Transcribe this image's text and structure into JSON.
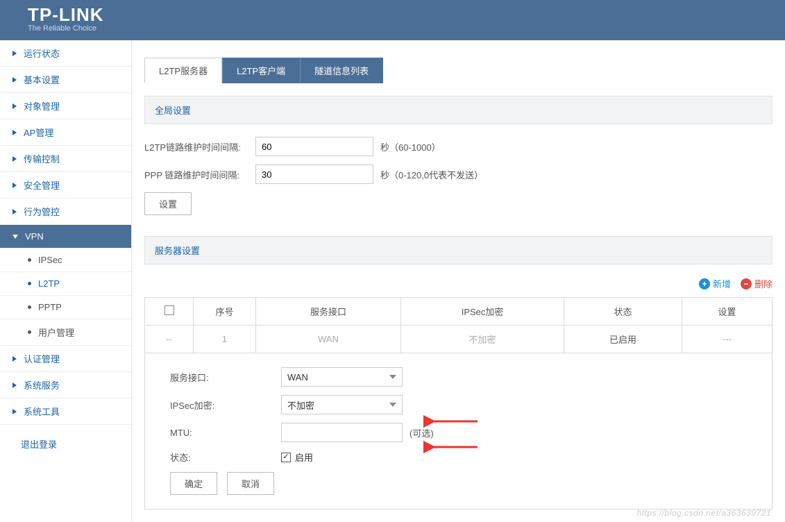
{
  "brand": {
    "name": "TP-LINK",
    "tagline": "The Reliable Choice"
  },
  "sidebar": {
    "items": [
      {
        "label": "运行状态"
      },
      {
        "label": "基本设置"
      },
      {
        "label": "对象管理"
      },
      {
        "label": "AP管理"
      },
      {
        "label": "传输控制"
      },
      {
        "label": "安全管理"
      },
      {
        "label": "行为管控"
      },
      {
        "label": "VPN",
        "active": true
      },
      {
        "label": "IPSec",
        "sub": true
      },
      {
        "label": "L2TP",
        "sub": true,
        "highlight": true
      },
      {
        "label": "PPTP",
        "sub": true
      },
      {
        "label": "用户管理",
        "sub": true
      },
      {
        "label": "认证管理"
      },
      {
        "label": "系统服务"
      },
      {
        "label": "系统工具"
      }
    ],
    "logout": "退出登录"
  },
  "tabs": [
    {
      "label": "L2TP服务器",
      "active": true
    },
    {
      "label": "L2TP客户端"
    },
    {
      "label": "隧道信息列表"
    }
  ],
  "global": {
    "section_title": "全局设置",
    "rows": [
      {
        "label": "L2TP链路维护时间间隔:",
        "value": "60",
        "hint": "秒（60-1000）"
      },
      {
        "label": "PPP 链路维护时间间隔:",
        "value": "30",
        "hint": "秒（0-120,0代表不发送）"
      }
    ],
    "button": "设置"
  },
  "server": {
    "section_title": "服务器设置",
    "add_label": "新增",
    "del_label": "删除",
    "headers": [
      "序号",
      "服务接口",
      "IPSec加密",
      "状态",
      "设置"
    ],
    "row": {
      "dash": "--",
      "seq": "1",
      "iface": "WAN",
      "ipsec": "不加密",
      "status": "已启用",
      "ops": "---"
    },
    "form": {
      "iface_label": "服务接口:",
      "iface_value": "WAN",
      "ipsec_label": "IPSec加密:",
      "ipsec_value": "不加密",
      "mtu_label": "MTU:",
      "mtu_value": "",
      "mtu_hint": "(可选)",
      "status_label": "状态:",
      "status_value": "启用",
      "ok": "确定",
      "cancel": "取消"
    }
  },
  "watermark": "https://blog.csdn.net/a363639721"
}
